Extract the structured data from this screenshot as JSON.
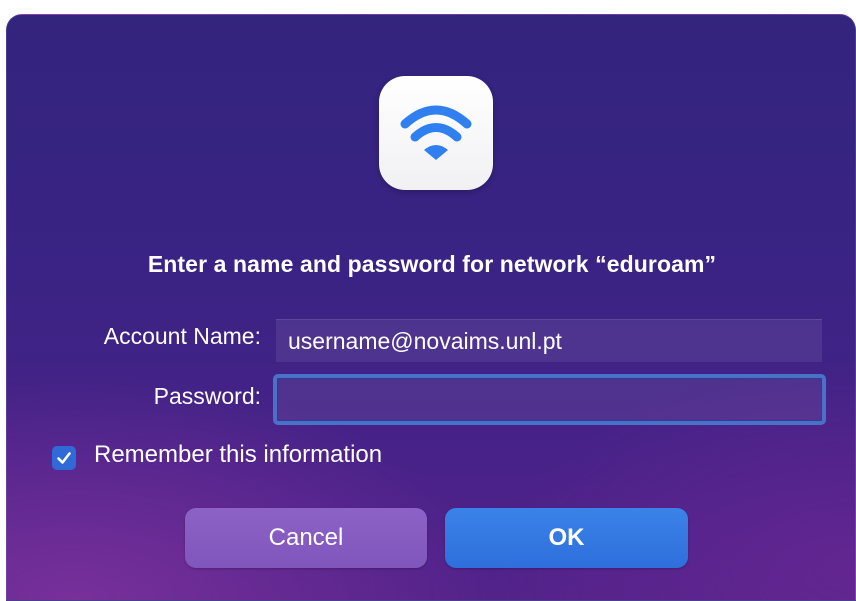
{
  "dialog": {
    "title": "Enter a name and password for network “eduroam”",
    "icon": "wifi-icon",
    "account_label": "Account Name:",
    "account_value": "username@novaims.unl.pt",
    "password_label": "Password:",
    "password_value": "",
    "remember_label": "Remember this information",
    "remember_checked": true,
    "cancel_label": "Cancel",
    "ok_label": "OK"
  },
  "colors": {
    "background_top": "#33247e",
    "background_bottom": "#53238a",
    "wifi_icon": "#2f7ff0",
    "focus_ring": "#4a71c8",
    "checkbox": "#2f6ad6",
    "cancel_button": "#8d62c6",
    "ok_button": "#3a82e8"
  }
}
